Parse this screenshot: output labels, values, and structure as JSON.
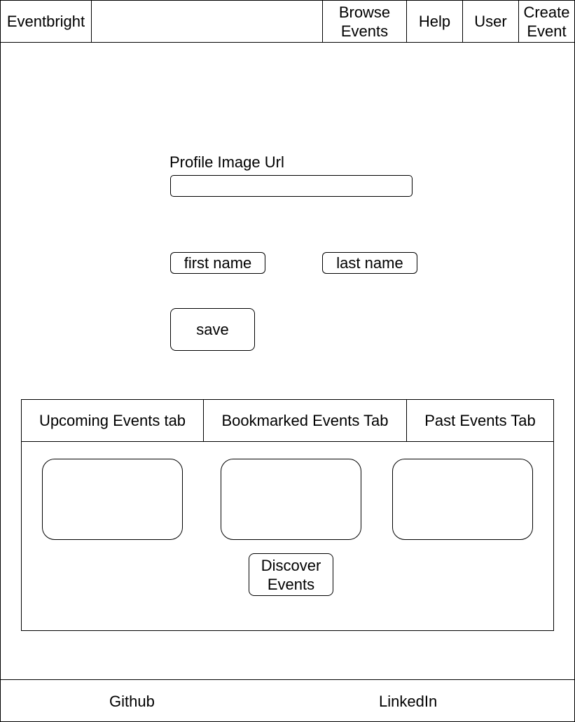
{
  "nav": {
    "brand": "Eventbright",
    "browse_line1": "Browse",
    "browse_line2": "Events",
    "help": "Help",
    "user": "User",
    "create_line1": "Create",
    "create_line2": "Event"
  },
  "profile": {
    "image_url_label": "Profile Image Url",
    "image_url_value": "",
    "first_name": "first name",
    "last_name": "last name",
    "save": "save"
  },
  "events": {
    "tabs": [
      {
        "label": "Upcoming Events tab"
      },
      {
        "label": "Bookmarked Events Tab"
      },
      {
        "label": "Past Events Tab"
      }
    ],
    "discover_line1": "Discover",
    "discover_line2": "Events"
  },
  "footer": {
    "github": "Github",
    "linkedin": "LinkedIn"
  }
}
